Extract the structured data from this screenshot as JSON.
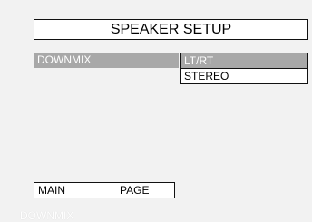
{
  "title": "SPEAKER SETUP",
  "setting": {
    "label": "DOWNMIX",
    "options": [
      {
        "label": "LT/RT",
        "selected": true
      },
      {
        "label": "STEREO",
        "selected": false
      }
    ]
  },
  "bottom": {
    "main": "MAIN",
    "page": "PAGE"
  },
  "status": "DOWNMIX",
  "colors": {
    "background": "#f2f2f2",
    "highlight": "#a8a8a8",
    "border": "#111111",
    "panel": "#ffffff"
  }
}
